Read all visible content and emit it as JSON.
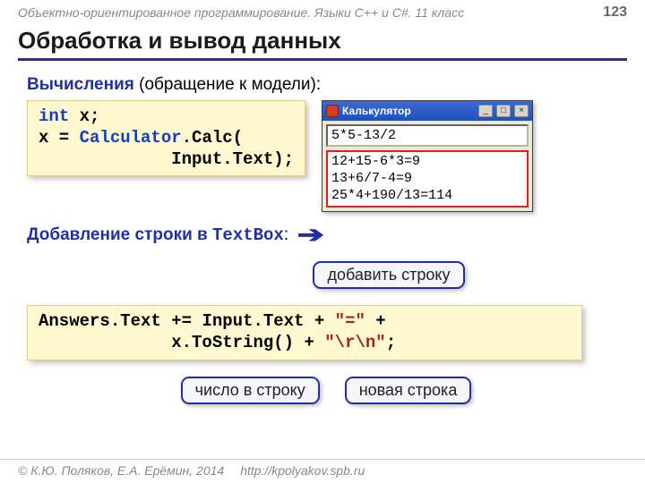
{
  "header": {
    "course": "Объектно-ориентированное программирование. Языки C++ и C#. 11 класс",
    "page_num": "123"
  },
  "title": "Обработка и вывод данных",
  "sub1": {
    "kw": "Вычисления",
    "rest": " (обращение к модели):"
  },
  "code1": {
    "l1a": "int",
    "l1b": " x;",
    "l2a": "x = ",
    "l2b": "Calculator",
    "l2c": ".Calc(",
    "l3": "             Input.Text);"
  },
  "sub2": {
    "kw": "Добавление строки в ",
    "mono": "TextBox",
    "tail": ":"
  },
  "bubble_add": "добавить строку",
  "code2": {
    "l1a": "Answers.Text",
    "l1b": " += ",
    "l1c": "Input.Text + ",
    "l1d": "\"=\"",
    "l1e": " +",
    "l2a": "             x.ToString() + ",
    "l2b": "\"\\r\\n\"",
    "l2c": ";"
  },
  "bubble_num": "число в строку",
  "bubble_newline": "новая строка",
  "win": {
    "title": "Калькулятор",
    "input": "5*5-13/2",
    "answers": "12+15-6*3=9\n13+6/7-4=9\n25*4+190/13=114"
  },
  "footer": {
    "copyright": "© К.Ю. Поляков, Е.А. Ерёмин, 2014",
    "url": "http://kpolyakov.spb.ru"
  }
}
